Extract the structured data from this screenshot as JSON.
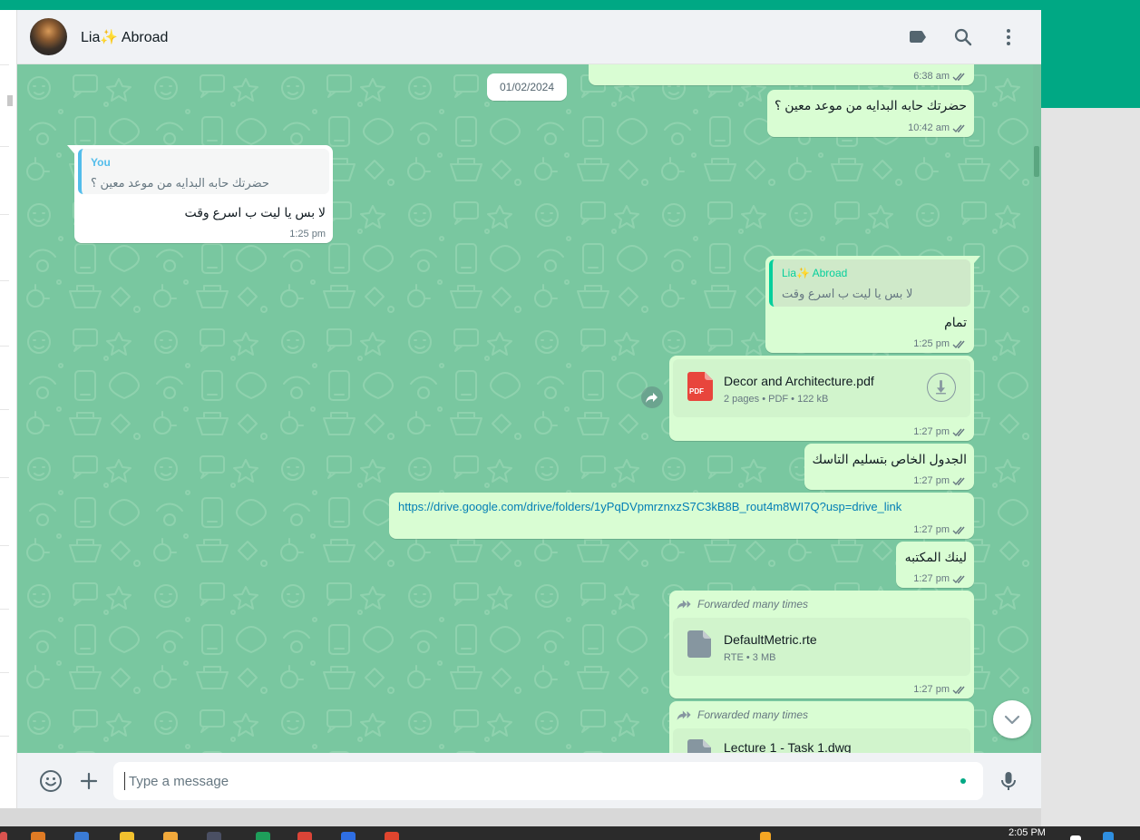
{
  "header": {
    "contact_name": "Lia✨ Abroad"
  },
  "date_chip": "01/02/2024",
  "messages": {
    "m0": {
      "time": "6:38 am"
    },
    "m1": {
      "text": "حضرتك حابه البدايه من موعد معين ؟",
      "time": "10:42 am"
    },
    "m2": {
      "quote_author": "You",
      "quote_text": "حضرتك حابه البدايه من موعد معين ؟",
      "text": "لا بس يا ليت ب اسرع وقت",
      "time": "1:25 pm"
    },
    "m3": {
      "quote_author": "Lia✨ Abroad",
      "quote_text": "لا بس يا ليت ب اسرع وقت",
      "text": "تمام",
      "time": "1:25 pm"
    },
    "m4": {
      "file_name": "Decor and Architecture.pdf",
      "file_info": "2 pages • PDF • 122 kB",
      "file_badge": "PDF",
      "time": "1:27 pm"
    },
    "m5": {
      "text": "الجدول الخاص بتسليم التاسك",
      "time": "1:27 pm"
    },
    "m6": {
      "link": "https://drive.google.com/drive/folders/1yPqDVpmrznxzS7C3kB8B_rout4m8WI7Q?usp=drive_link",
      "time": "1:27 pm"
    },
    "m7": {
      "text": "لينك المكتبه",
      "time": "1:27 pm"
    },
    "m8": {
      "forwarded": "Forwarded many times",
      "file_name": "DefaultMetric.rte",
      "file_info": "RTE • 3 MB",
      "time": "1:27 pm"
    },
    "m9": {
      "forwarded": "Forwarded many times",
      "file_name": "Lecture 1 - Task 1.dwg"
    }
  },
  "composer": {
    "placeholder": "Type a message"
  },
  "taskbar": {
    "clock": "2:05 PM"
  },
  "colors": {
    "accent": "#00a884",
    "outgoing_bubble": "#d9fdd3",
    "incoming_bubble": "#ffffff",
    "wallpaper": "#79c7a0",
    "link": "#027eb5",
    "tick_read": "#667781"
  },
  "icons": [
    "label-icon",
    "search-icon",
    "menu-icon",
    "emoji-icon",
    "plus-icon",
    "mic-icon",
    "download-icon",
    "forward-icon",
    "pdf-icon",
    "file-icon",
    "chevron-down-icon",
    "double-check-icon"
  ]
}
